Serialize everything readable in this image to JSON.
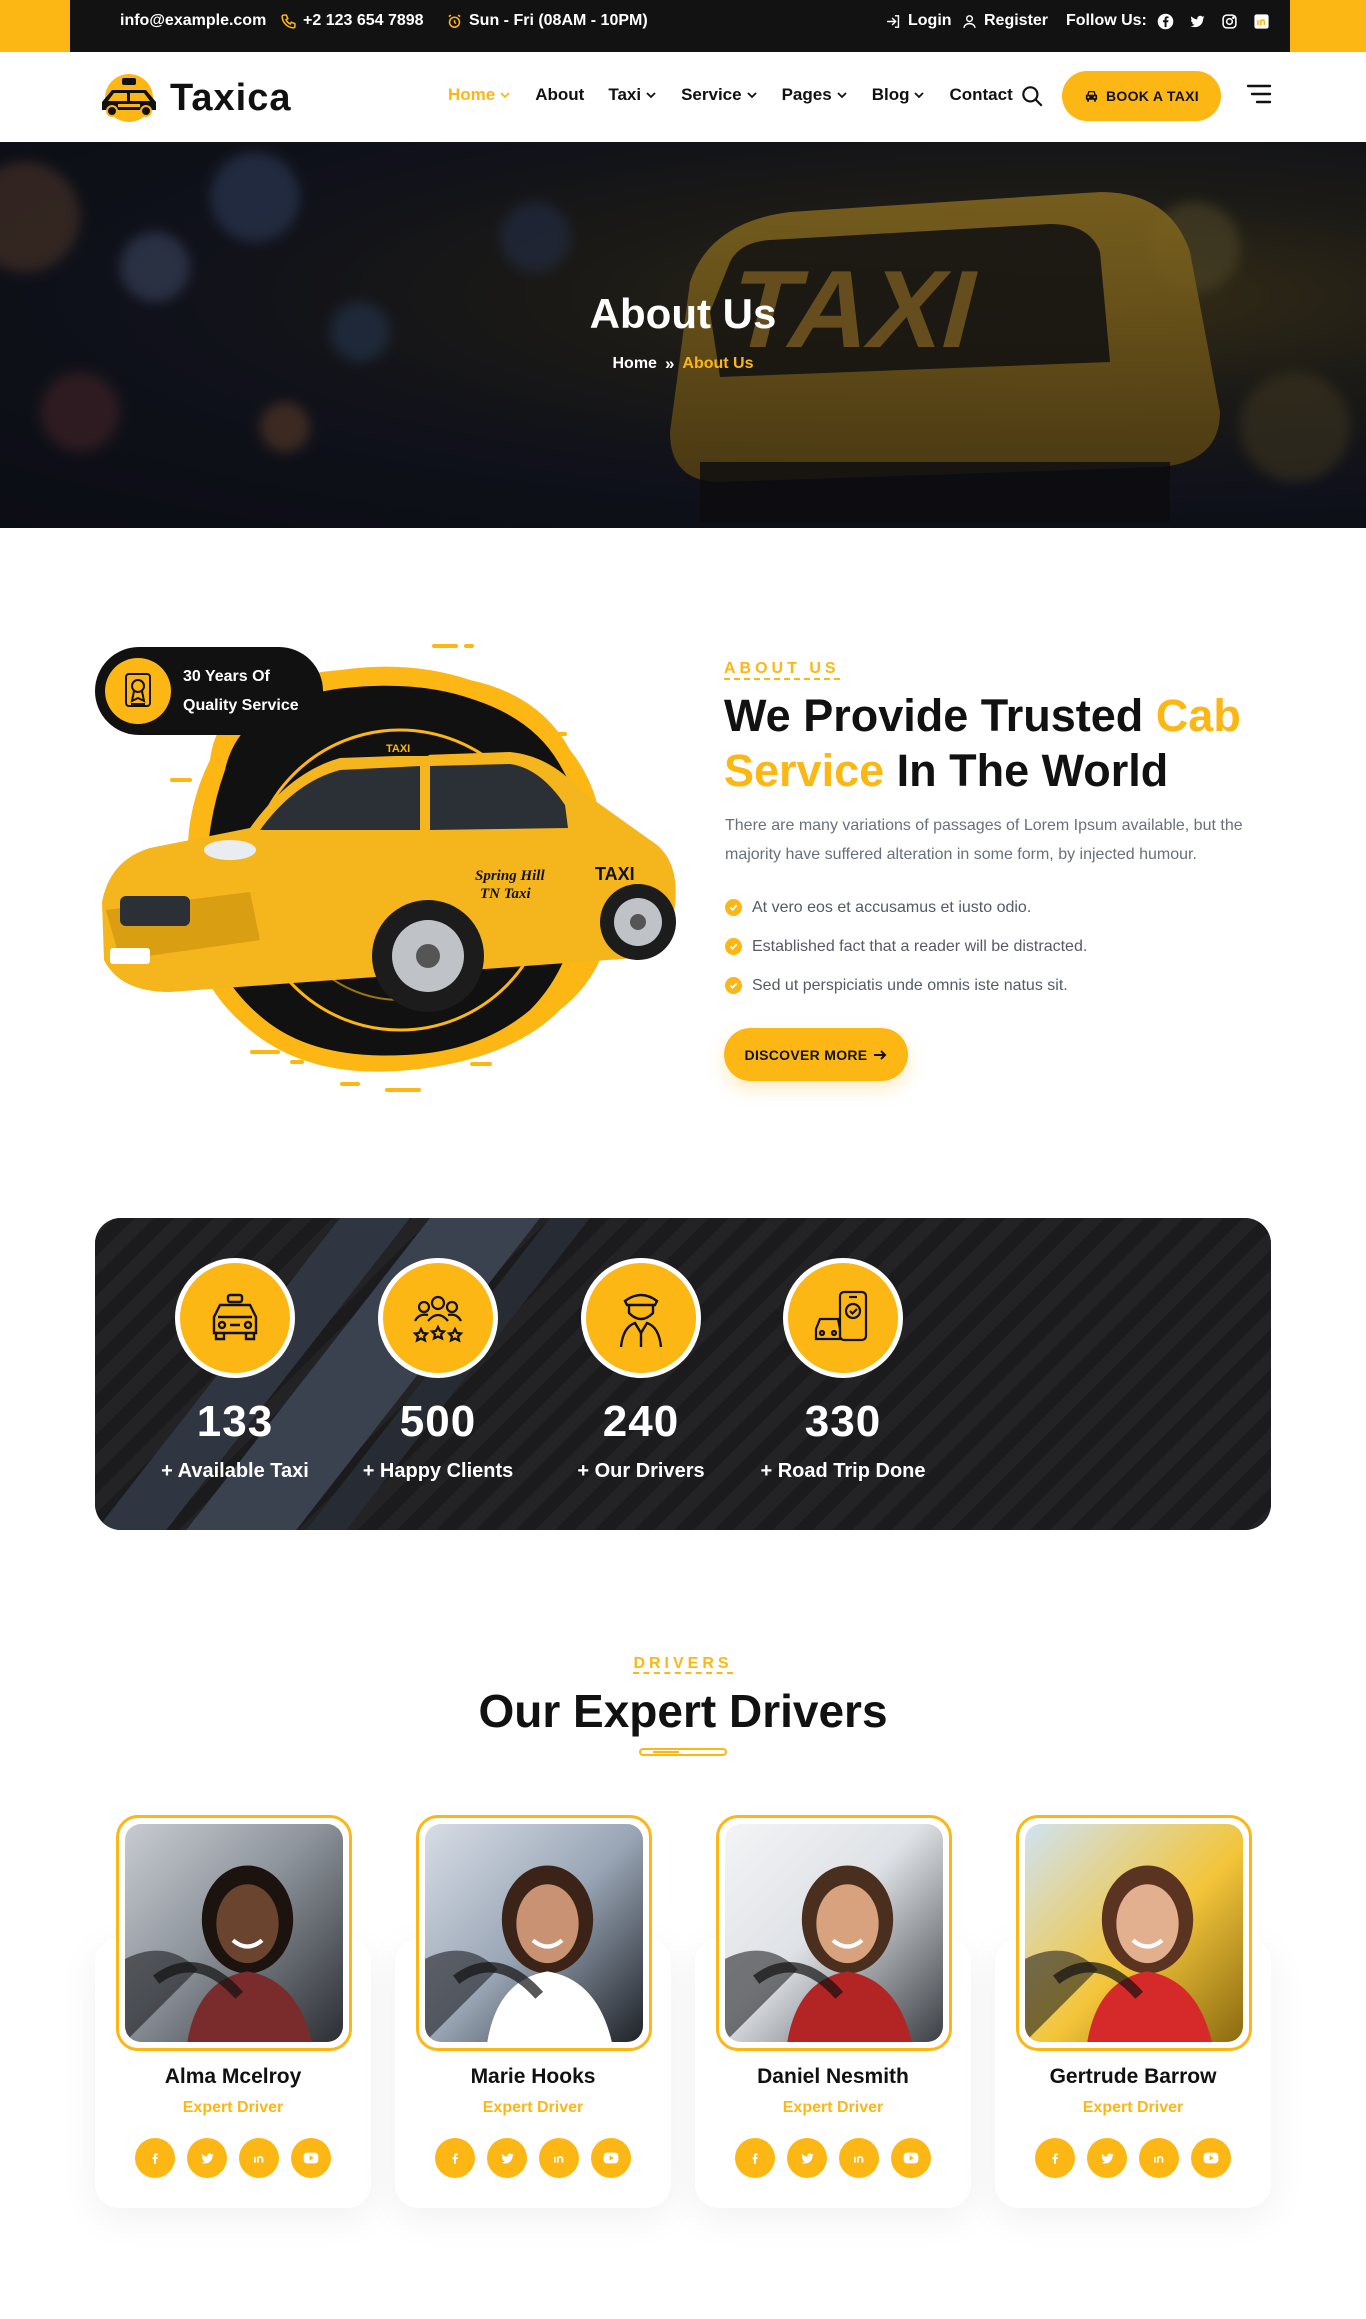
{
  "topbar": {
    "email": "info@example.com",
    "phone": "+2 123 654 7898",
    "hours": "Sun - Fri (08AM - 10PM)",
    "login": "Login",
    "register": "Register",
    "follow": "Follow Us:",
    "socials": [
      "facebook-icon",
      "twitter-icon",
      "instagram-icon",
      "linkedin-icon"
    ]
  },
  "header": {
    "logo_text": "Taxica",
    "nav": [
      {
        "label": "Home",
        "active": true,
        "dropdown": true
      },
      {
        "label": "About",
        "active": false,
        "dropdown": false
      },
      {
        "label": "Taxi",
        "active": false,
        "dropdown": true
      },
      {
        "label": "Service",
        "active": false,
        "dropdown": true
      },
      {
        "label": "Pages",
        "active": false,
        "dropdown": true
      },
      {
        "label": "Blog",
        "active": false,
        "dropdown": true
      },
      {
        "label": "Contact",
        "active": false,
        "dropdown": false
      }
    ],
    "book_button": "BOOK A TAXI"
  },
  "hero": {
    "title": "About Us",
    "breadcrumb_home": "Home",
    "breadcrumb_current": "About Us"
  },
  "about": {
    "badge_text": "30 Years Of Quality Service",
    "kicker": "ABOUT US",
    "title_part1": "We Provide Trusted ",
    "title_highlight1": "Cab Service",
    "title_part2": " In The World",
    "description": "There are many variations of passages of Lorem Ipsum available, but the majority have suffered alteration in some form, by injected humour.",
    "checklist": [
      "At vero eos et accusamus et iusto odio.",
      "Established fact that a reader will be distracted.",
      "Sed ut perspiciatis unde omnis iste natus sit."
    ],
    "button": "DISCOVER MORE"
  },
  "stats": [
    {
      "number": "133",
      "label": "+ Available Taxi",
      "icon": "taxi-icon"
    },
    {
      "number": "500",
      "label": "+ Happy Clients",
      "icon": "clients-icon"
    },
    {
      "number": "240",
      "label": "+ Our Drivers",
      "icon": "driver-icon"
    },
    {
      "number": "330",
      "label": "+ Road Trip Done",
      "icon": "mobile-booking-icon"
    }
  ],
  "drivers": {
    "kicker": "DRIVERS",
    "title": "Our Expert Drivers",
    "list": [
      {
        "name": "Alma Mcelroy",
        "role": "Expert Driver"
      },
      {
        "name": "Marie Hooks",
        "role": "Expert Driver"
      },
      {
        "name": "Daniel Nesmith",
        "role": "Expert Driver"
      },
      {
        "name": "Gertrude Barrow",
        "role": "Expert Driver"
      }
    ]
  },
  "colors": {
    "accent": "#fdb714",
    "dark": "#121212",
    "text_muted": "#6a6f7b"
  }
}
